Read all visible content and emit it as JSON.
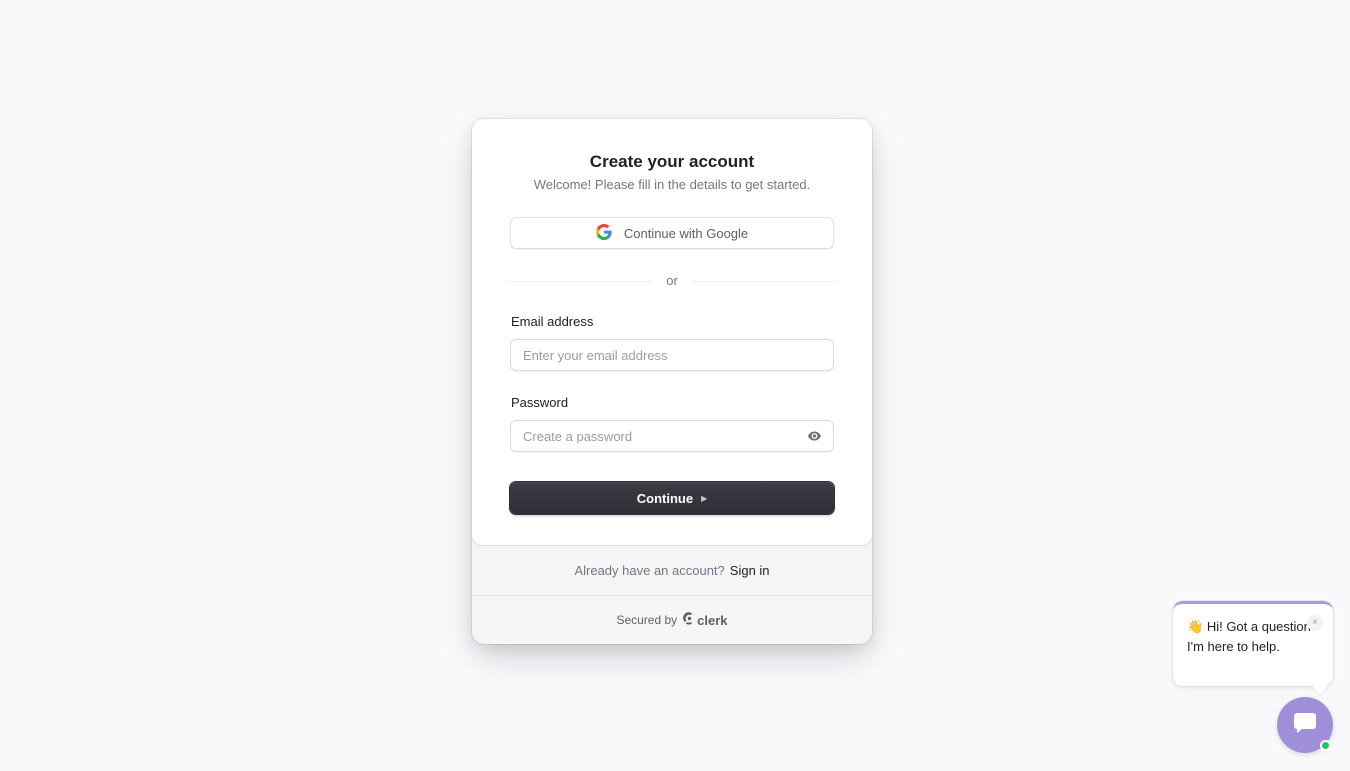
{
  "signup": {
    "title": "Create your account",
    "subtitle": "Welcome! Please fill in the details to get started.",
    "google_button_label": "Continue with Google",
    "divider_text": "or",
    "email": {
      "label": "Email address",
      "placeholder": "Enter your email address",
      "value": ""
    },
    "password": {
      "label": "Password",
      "placeholder": "Create a password",
      "value": ""
    },
    "continue_label": "Continue"
  },
  "footer": {
    "prompt": "Already have an account?",
    "sign_in_label": "Sign in",
    "secured_by": "Secured by",
    "brand": "clerk"
  },
  "chat": {
    "greeting_emoji": "👋",
    "message": "Hi! Got a question? I'm here to help.",
    "close_glyph": "×",
    "status": "online"
  },
  "colors": {
    "primary_button": "#2f3037",
    "chat_accent": "#9e8fd8",
    "online": "#22c55e"
  },
  "icons": [
    "google-icon",
    "eye-icon",
    "play-arrow-icon",
    "clerk-logo-icon",
    "close-icon",
    "chat-icon"
  ]
}
